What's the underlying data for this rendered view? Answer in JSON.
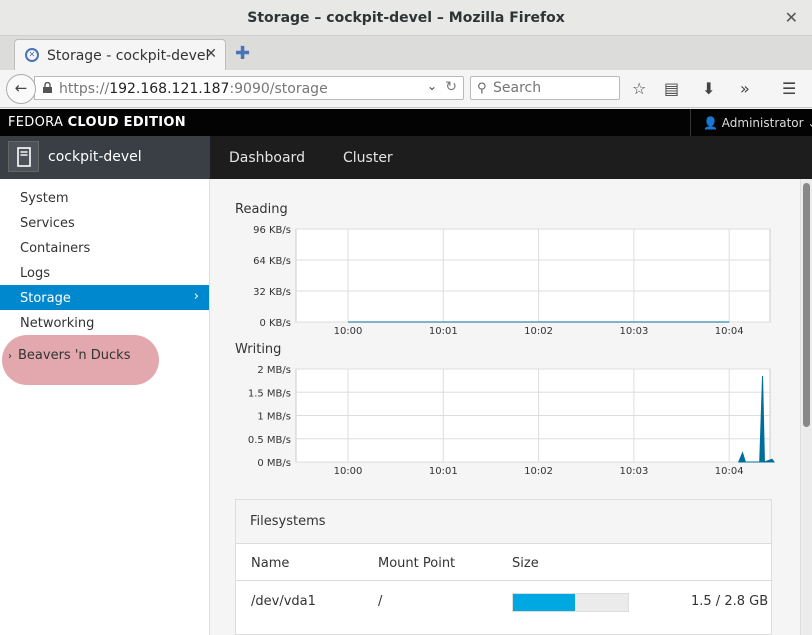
{
  "window": {
    "title": "Storage – cockpit-devel – Mozilla Firefox"
  },
  "tab": {
    "label": "Storage - cockpit-devel"
  },
  "url": {
    "prefix": "https://",
    "host": "192.168.121.187",
    "rest": ":9090/storage"
  },
  "search": {
    "placeholder": "Search"
  },
  "brand": {
    "light": "FEDORA ",
    "bold": "CLOUD EDITION"
  },
  "user": {
    "label": "Administrator"
  },
  "host": {
    "name": "cockpit-devel"
  },
  "topnav": [
    "Dashboard",
    "Cluster"
  ],
  "sidebar": {
    "items": [
      "System",
      "Services",
      "Containers",
      "Logs",
      "Storage",
      "Networking"
    ],
    "active": "Storage",
    "group": "Beavers 'n Ducks"
  },
  "colors": {
    "accent": "#0088ce",
    "series": "#006e9c",
    "usage": "#00a8e1"
  },
  "chart_data": [
    {
      "type": "area",
      "title": "Reading",
      "yticks": [
        "96 KB/s",
        "64 KB/s",
        "32 KB/s",
        "0 KB/s"
      ],
      "xticks": [
        "10:00",
        "10:01",
        "10:02",
        "10:03",
        "10:04"
      ],
      "ylim": [
        0,
        96
      ],
      "unit": "KB/s",
      "grid": true,
      "series": [
        {
          "values": [
            [
              10.0,
              0
            ],
            [
              10.04,
              0
            ]
          ]
        }
      ]
    },
    {
      "type": "area",
      "title": "Writing",
      "yticks": [
        "2 MB/s",
        "1.5 MB/s",
        "1 MB/s",
        "0.5 MB/s",
        "0 MB/s"
      ],
      "xticks": [
        "10:00",
        "10:01",
        "10:02",
        "10:03",
        "10:04"
      ],
      "ylim": [
        0,
        2
      ],
      "unit": "MB/s",
      "grid": true,
      "series": [
        {
          "values": [
            [
              4.1,
              0
            ],
            [
              4.14,
              0.2
            ],
            [
              4.17,
              0
            ],
            [
              4.32,
              0
            ],
            [
              4.35,
              1.85
            ],
            [
              4.37,
              0
            ],
            [
              4.45,
              0.06
            ],
            [
              4.47,
              0
            ]
          ]
        }
      ]
    }
  ],
  "filesystems": {
    "title": "Filesystems",
    "headers": {
      "name": "Name",
      "mount": "Mount Point",
      "size": "Size"
    },
    "rows": [
      {
        "name": "/dev/vda1",
        "mount": "/",
        "usage": 0.536,
        "size": "1.5 / 2.8 GB"
      }
    ]
  }
}
